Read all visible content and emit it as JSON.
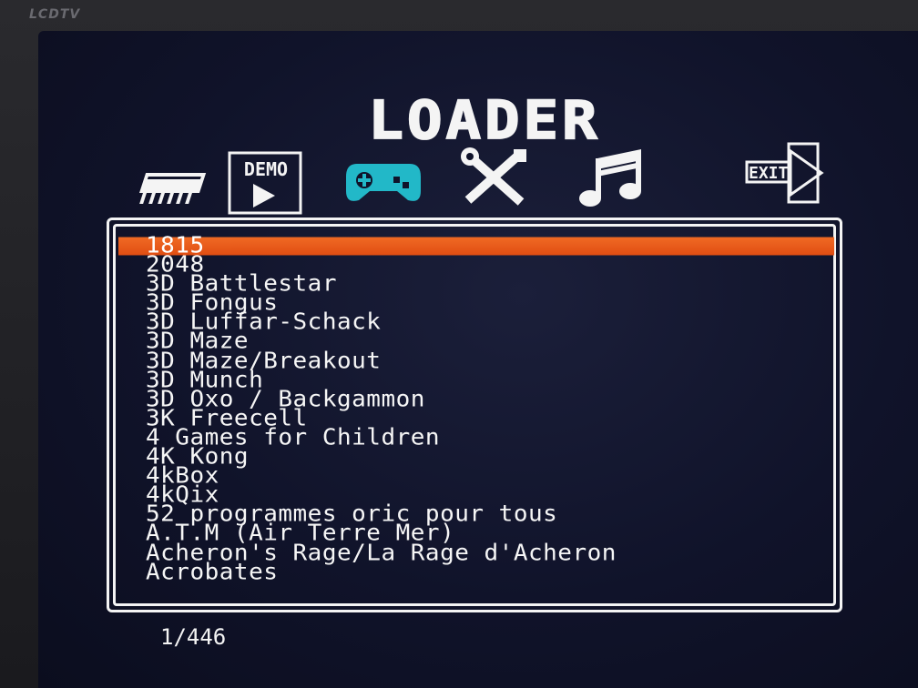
{
  "tv": {
    "brand": "LCDTV"
  },
  "loader": {
    "title": "LOADER",
    "toolbar": {
      "chip": {
        "icon": "chip-icon"
      },
      "demo": {
        "icon": "demo-play-icon",
        "label": "DEMO"
      },
      "games": {
        "icon": "gamepad-icon",
        "active_color": "#22b8c8"
      },
      "tools": {
        "icon": "tools-icon"
      },
      "music": {
        "icon": "music-note-icon"
      },
      "exit": {
        "icon": "exit-icon",
        "label": "EXIT"
      }
    },
    "list": {
      "selected_index": 0,
      "items": [
        "1815",
        "2048",
        "3D Battlestar",
        "3D Fongus",
        "3D Luffar-Schack",
        "3D Maze",
        "3D Maze/Breakout",
        "3D Munch",
        "3D Oxo / Backgammon",
        "3K Freecell",
        "4 Games for Children",
        "4K Kong",
        "4kBox",
        "4kQix",
        "52 programmes oric pour tous",
        "A.T.M (Air Terre Mer)",
        "Acheron's Rage/La Rage d'Acheron",
        "Acrobates"
      ]
    },
    "counter": "1/446",
    "colors": {
      "selection": "#e8581a",
      "text": "#f4f4f4",
      "background": "#10132a"
    }
  }
}
